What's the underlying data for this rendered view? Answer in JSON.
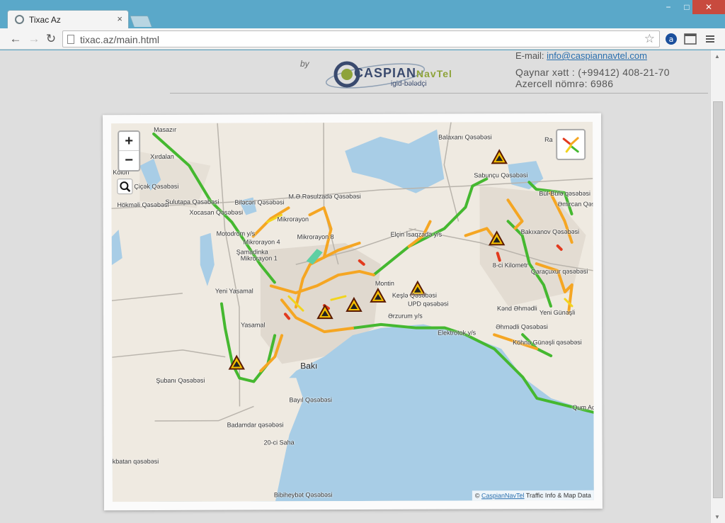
{
  "browser": {
    "tab_title": "Tixac Az",
    "tab_close": "×",
    "url": "tixac.az/main.html",
    "window_controls": {
      "minimize": "−",
      "restore": "□",
      "close": "✕"
    }
  },
  "header": {
    "by": "by",
    "logo_text_caspian": "CASPIAN",
    "logo_text_navtel": "NavTel",
    "logo_sub": "igid-bələdçi",
    "email_label": "E-mail:",
    "email": "info@caspiannavtel.com",
    "hotline": "Qaynar xətt : (+99412) 408-21-70",
    "azercell": "Azercell nömrə: 6986"
  },
  "map": {
    "zoom_in": "+",
    "zoom_out": "−",
    "attribution_prefix": "© ",
    "attribution_link": "CaspianNavTel",
    "attribution_rest": " Traffic Info & Map Data",
    "labels": {
      "masazir": "Masazır",
      "xirdalan": "Xırdalan",
      "xkolon": "x Kolon",
      "cicek": "Çiçək Qəsəbəsi",
      "hokmali": "Hökməli Qəsəbəsi",
      "sulutapa": "Sulutapa Qəsəbəsi",
      "bilecer": "Biləcəri Qəsəbəsi",
      "xocasan": "Xocasan Qəsəbəsi",
      "rasulzada": "M.Ə.Rəsulzadə Qəsəbəsi",
      "mikrorayon": "Mikrorayon",
      "mikrorayon8": "Mikrorayon 8",
      "motodrom": "Motodrom y/s",
      "mikrorayon4": "Mikrorayon 4",
      "samadinka": "Şamadinka",
      "mikrorayon1": "Mikrorayon 1",
      "yeniyasamal": "Yeni Yasamal",
      "yasamal": "Yasamal",
      "subani": "Şubanı Qəsəbəsi",
      "baki": "Bakı",
      "bayil": "Bayıl Qəsəbəsi",
      "badamdar": "Badamdar qəsəbəsi",
      "saha20": "20-ci Saha",
      "bibiheybet": "Bibiheybət Qəsəbəsi",
      "kbatan": "kbatan qəsəbəsi",
      "balaxani": "Balaxanı Qəsəbəsi",
      "sabuncu": "Sabunçu Qəsəbəsi",
      "bulbula": "Bül-Bülə qəsəbəsi",
      "amircan": "Əmircan Qəsə",
      "bakixanov": "Bakıxanov Qəsəbəsi",
      "elcin": "Elçin İsaqzadə y/s",
      "montin": "Montin",
      "kesla": "Keşlə Qəsəbəsi",
      "upd": "UPD qəsəbəsi",
      "erzurum": "Ərzurum y/s",
      "kilometr8": "8-ci Kilometr",
      "qaracuxur": "Qaraçuxur qəsəbəsi",
      "kendahmedli": "Kənd Əhmədli",
      "yenigunesli": "Yeni Günəşli",
      "ehmedli": "Əhmədli Qəsəbəsi",
      "elektrotok": "Elektrotok y/s",
      "kohnagunesli": "Köhnə Günəşli qəsəbəsi",
      "qumad": "Qum Ad",
      "ra": "Ra"
    },
    "colors": {
      "water": "#a8cde6",
      "land": "#efeae1",
      "urban": "#dfd9d0",
      "green_traffic": "#45b830",
      "orange_traffic": "#f5a623",
      "yellow_traffic": "#f2d41d",
      "red_traffic": "#e23a1e"
    }
  }
}
